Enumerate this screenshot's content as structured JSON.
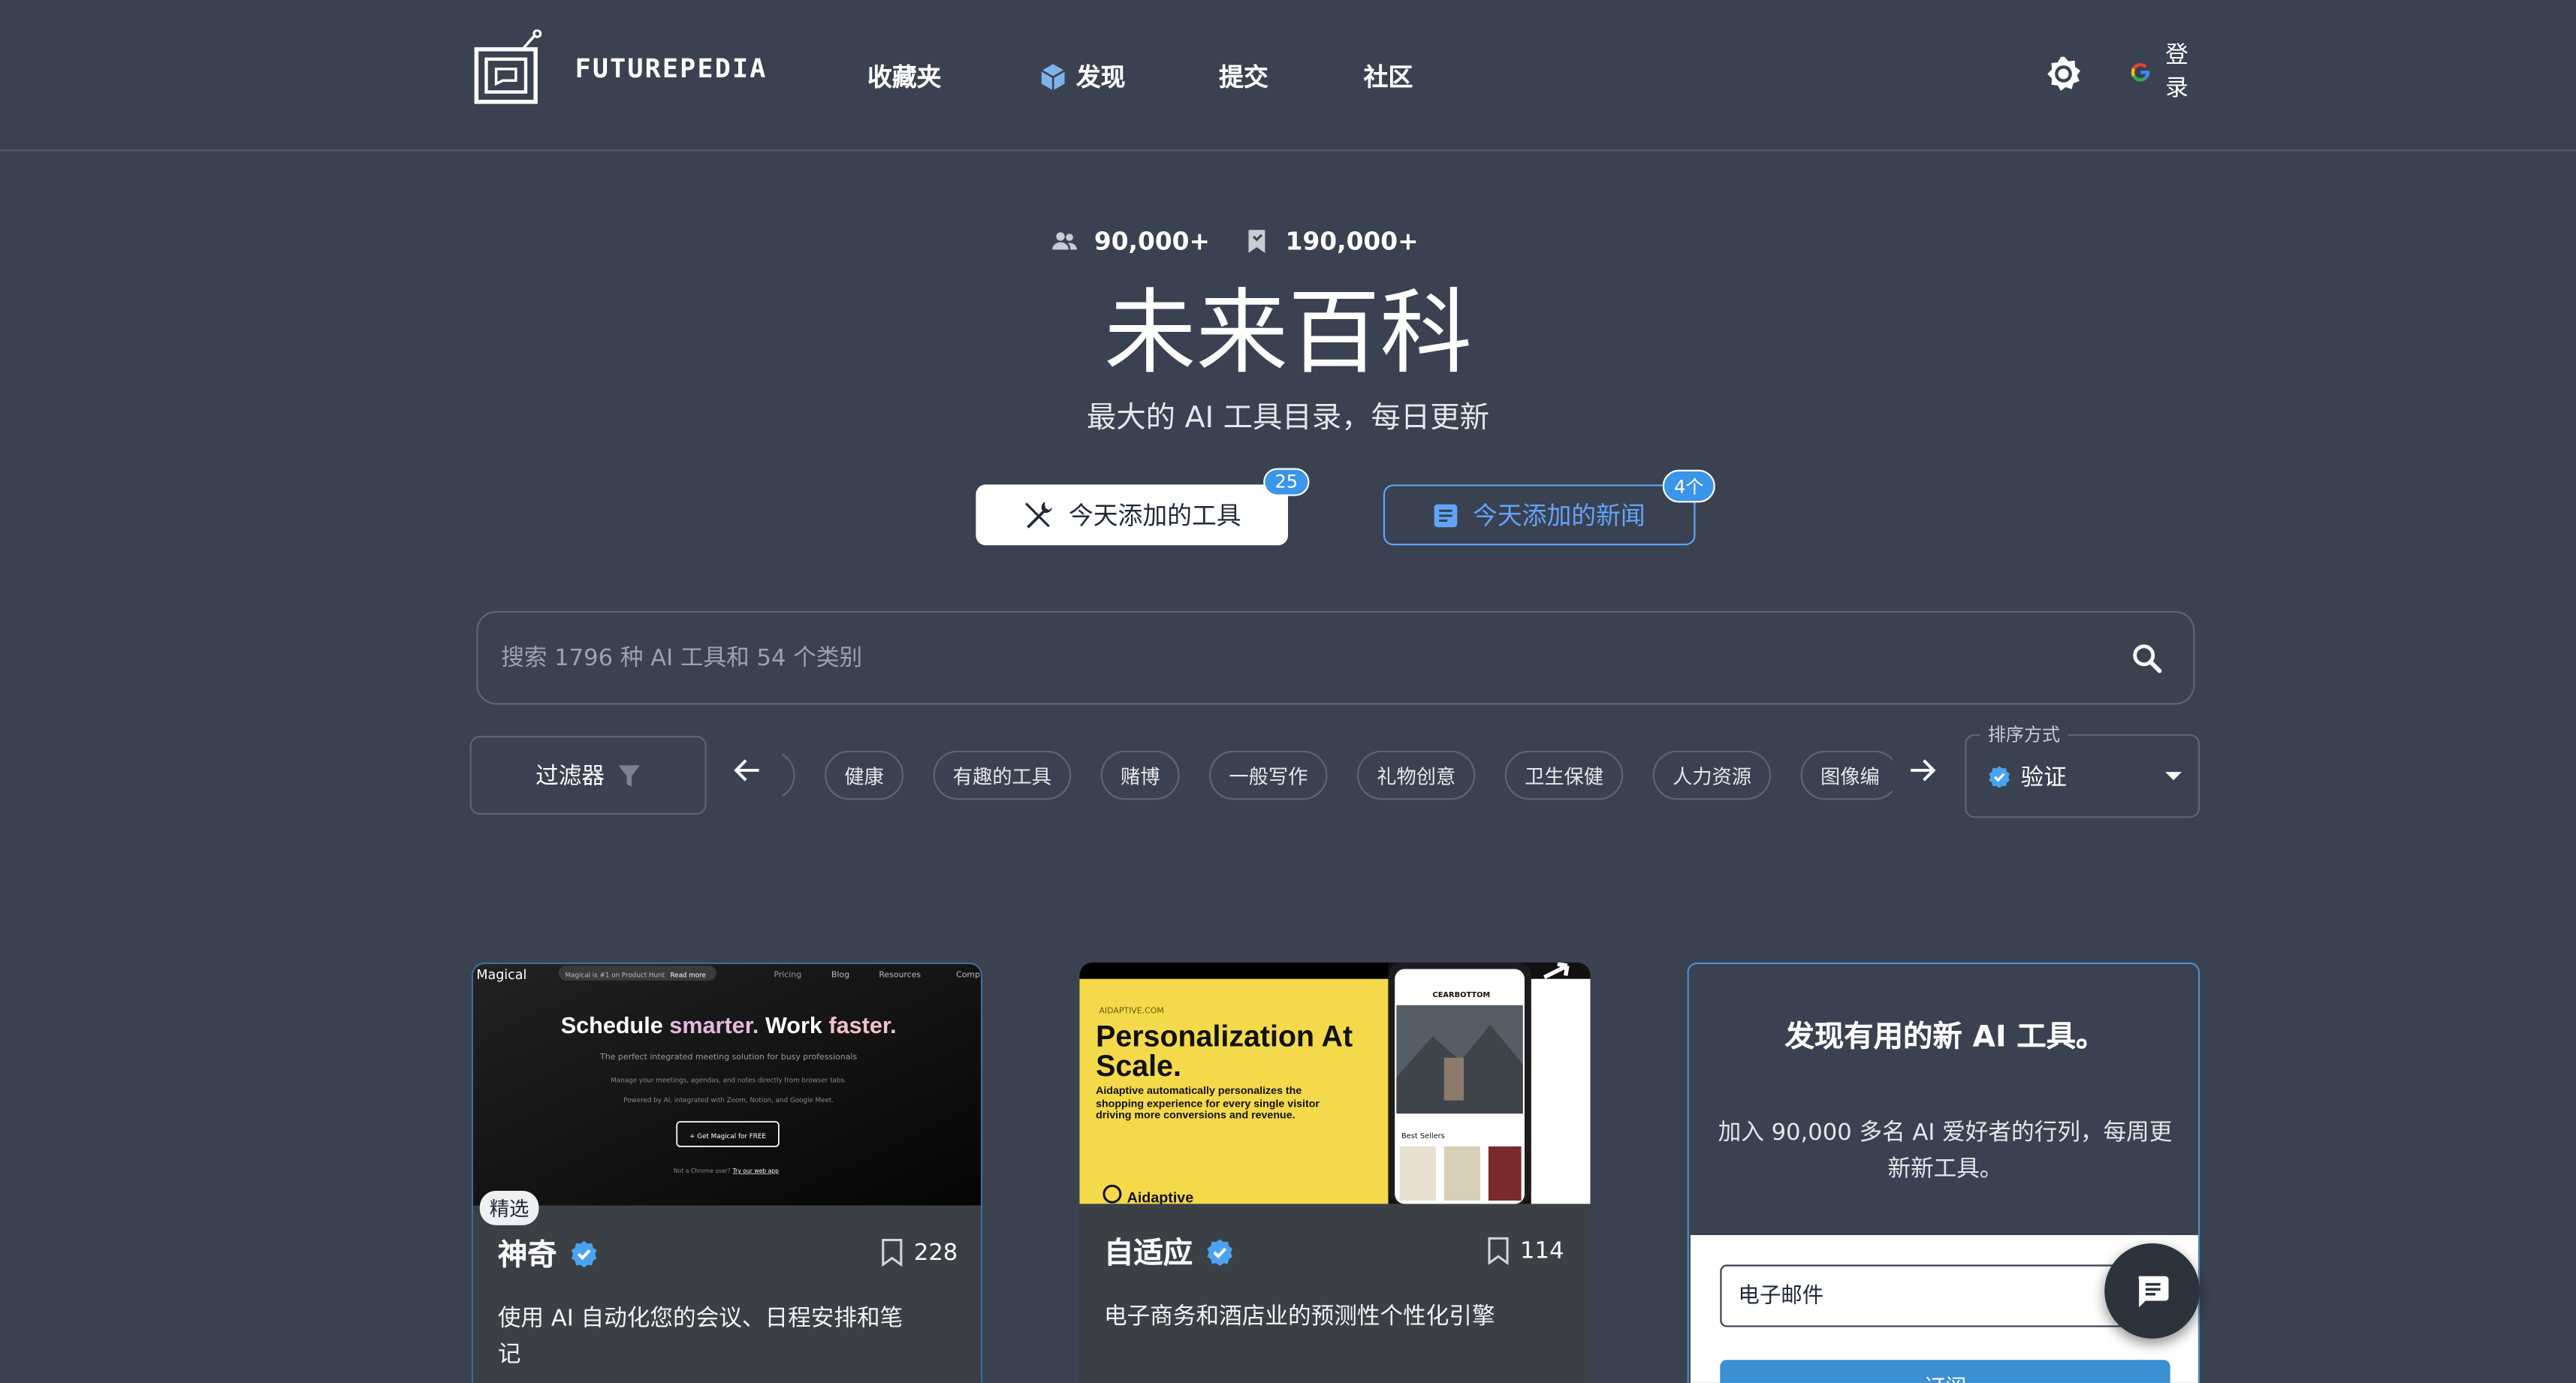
{
  "header": {
    "logo_text": "FUTUREPEDIA",
    "nav": [
      {
        "label": "收藏夹"
      },
      {
        "label": "发现"
      },
      {
        "label": "提交"
      },
      {
        "label": "社区"
      }
    ],
    "login_label": "登录"
  },
  "stats": {
    "users": "90,000+",
    "bookmarks": "190,000+"
  },
  "hero": {
    "title": "未来百科",
    "subtitle": "最大的 AI 工具目录，每日更新"
  },
  "today": {
    "tools_label": "今天添加的工具",
    "tools_count": "25",
    "news_label": "今天添加的新闻",
    "news_count": "4个"
  },
  "search": {
    "placeholder": "搜索 1796 种 AI 工具和 54 个类别"
  },
  "filter": {
    "label": "过滤器"
  },
  "categories": [
    "健康",
    "有趣的工具",
    "赌博",
    "一般写作",
    "礼物创意",
    "卫生保健",
    "人力资源",
    "图像编"
  ],
  "sort": {
    "label": "排序方式",
    "value": "验证"
  },
  "cards": [
    {
      "name": "神奇",
      "saves": "228",
      "badge": "精选",
      "description": "使用 AI 自动化您的会议、日程安排和笔记",
      "image": {
        "brand": "Magical",
        "nav": [
          "Magical is #1 on Product Hunt",
          "Read more",
          "Pricing",
          "Blog",
          "Resources",
          "Comp"
        ],
        "headline_a": "Schedule",
        "headline_b": "smarter.",
        "headline_c": "Work",
        "headline_d": "faster.",
        "line1": "The perfect integrated meeting solution for busy professionals",
        "line2": "Manage your meetings, agendas, and notes directly from browser tabs.",
        "line3": "Powered by AI, integrated with Zoom, Notion, and Google Meet.",
        "cta": "+ Get Magical for FREE",
        "footer_a": "Not a Chrome user?",
        "footer_b": "Try our web app"
      }
    },
    {
      "name": "自适应",
      "saves": "114",
      "description": "电子商务和酒店业的预测性个性化引擎",
      "image": {
        "site": "AIDAPTIVE.COM",
        "headline": "Personalization At Scale.",
        "body": "Aidaptive automatically personalizes the shopping experience for every single visitor driving more conversions and revenue.",
        "brand": "Aidaptive",
        "phone_brand": "CEARBOTTOM",
        "phone_section": "Best Sellers"
      }
    }
  ],
  "newsletter": {
    "title": "发现有用的新 AI 工具。",
    "subtitle": "加入 90,000 多名 AI 爱好者的行列，每周更新新工具。",
    "email_placeholder": "电子邮件",
    "submit_label": "订阅"
  },
  "colors": {
    "background": "#3a4150",
    "accent": "#3b95e8",
    "card_body": "#3b3f46"
  }
}
